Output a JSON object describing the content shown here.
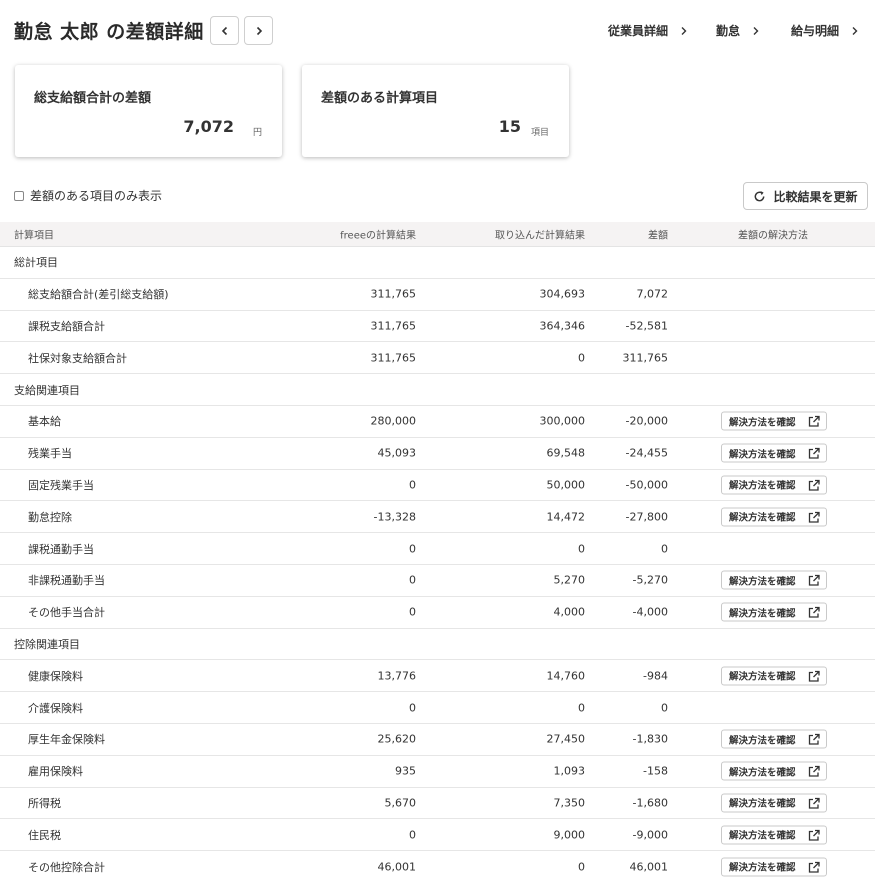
{
  "header": {
    "title": "勤怠 太郎 の差額詳細",
    "breadcrumbs": [
      {
        "label": "従業員詳細"
      },
      {
        "label": "勤怠"
      },
      {
        "label": "給与明細"
      }
    ]
  },
  "summary": {
    "total_diff": {
      "title": "総支給額合計の差額",
      "value": "7,072",
      "unit": "円"
    },
    "diff_items": {
      "title": "差額のある計算項目",
      "value": "15",
      "unit": "項目"
    }
  },
  "filter": {
    "checkbox_label": "差額のある項目のみ表示",
    "checked": false
  },
  "refresh_button": {
    "label": "比較結果を更新"
  },
  "table": {
    "columns": {
      "name": "計算項目",
      "freee": "freeeの計算結果",
      "imported": "取り込んだ計算結果",
      "diff": "差額",
      "action": "差額の解決方法"
    },
    "resolve_label": "解決方法を確認",
    "rows": [
      {
        "type": "section",
        "name": "総計項目"
      },
      {
        "type": "item",
        "name": "総支給額合計(差引総支給額)",
        "freee": "311,765",
        "imported": "304,693",
        "diff": "7,072",
        "action": false
      },
      {
        "type": "item",
        "name": "課税支給額合計",
        "freee": "311,765",
        "imported": "364,346",
        "diff": "-52,581",
        "action": false
      },
      {
        "type": "item",
        "name": "社保対象支給額合計",
        "freee": "311,765",
        "imported": "0",
        "diff": "311,765",
        "action": false
      },
      {
        "type": "section",
        "name": "支給関連項目"
      },
      {
        "type": "item",
        "name": "基本給",
        "freee": "280,000",
        "imported": "300,000",
        "diff": "-20,000",
        "action": true
      },
      {
        "type": "item",
        "name": "残業手当",
        "freee": "45,093",
        "imported": "69,548",
        "diff": "-24,455",
        "action": true
      },
      {
        "type": "item",
        "name": "固定残業手当",
        "freee": "0",
        "imported": "50,000",
        "diff": "-50,000",
        "action": true
      },
      {
        "type": "item",
        "name": "勤怠控除",
        "freee": "-13,328",
        "imported": "14,472",
        "diff": "-27,800",
        "action": true
      },
      {
        "type": "item",
        "name": "課税通勤手当",
        "freee": "0",
        "imported": "0",
        "diff": "0",
        "action": false
      },
      {
        "type": "item",
        "name": "非課税通勤手当",
        "freee": "0",
        "imported": "5,270",
        "diff": "-5,270",
        "action": true
      },
      {
        "type": "item",
        "name": "その他手当合計",
        "freee": "0",
        "imported": "4,000",
        "diff": "-4,000",
        "action": true
      },
      {
        "type": "section",
        "name": "控除関連項目"
      },
      {
        "type": "item",
        "name": "健康保険料",
        "freee": "13,776",
        "imported": "14,760",
        "diff": "-984",
        "action": true
      },
      {
        "type": "item",
        "name": "介護保険料",
        "freee": "0",
        "imported": "0",
        "diff": "0",
        "action": false
      },
      {
        "type": "item",
        "name": "厚生年金保険料",
        "freee": "25,620",
        "imported": "27,450",
        "diff": "-1,830",
        "action": true
      },
      {
        "type": "item",
        "name": "雇用保険料",
        "freee": "935",
        "imported": "1,093",
        "diff": "-158",
        "action": true
      },
      {
        "type": "item",
        "name": "所得税",
        "freee": "5,670",
        "imported": "7,350",
        "diff": "-1,680",
        "action": true
      },
      {
        "type": "item",
        "name": "住民税",
        "freee": "0",
        "imported": "9,000",
        "diff": "-9,000",
        "action": true
      },
      {
        "type": "item",
        "name": "その他控除合計",
        "freee": "46,001",
        "imported": "0",
        "diff": "46,001",
        "action": true
      }
    ]
  }
}
